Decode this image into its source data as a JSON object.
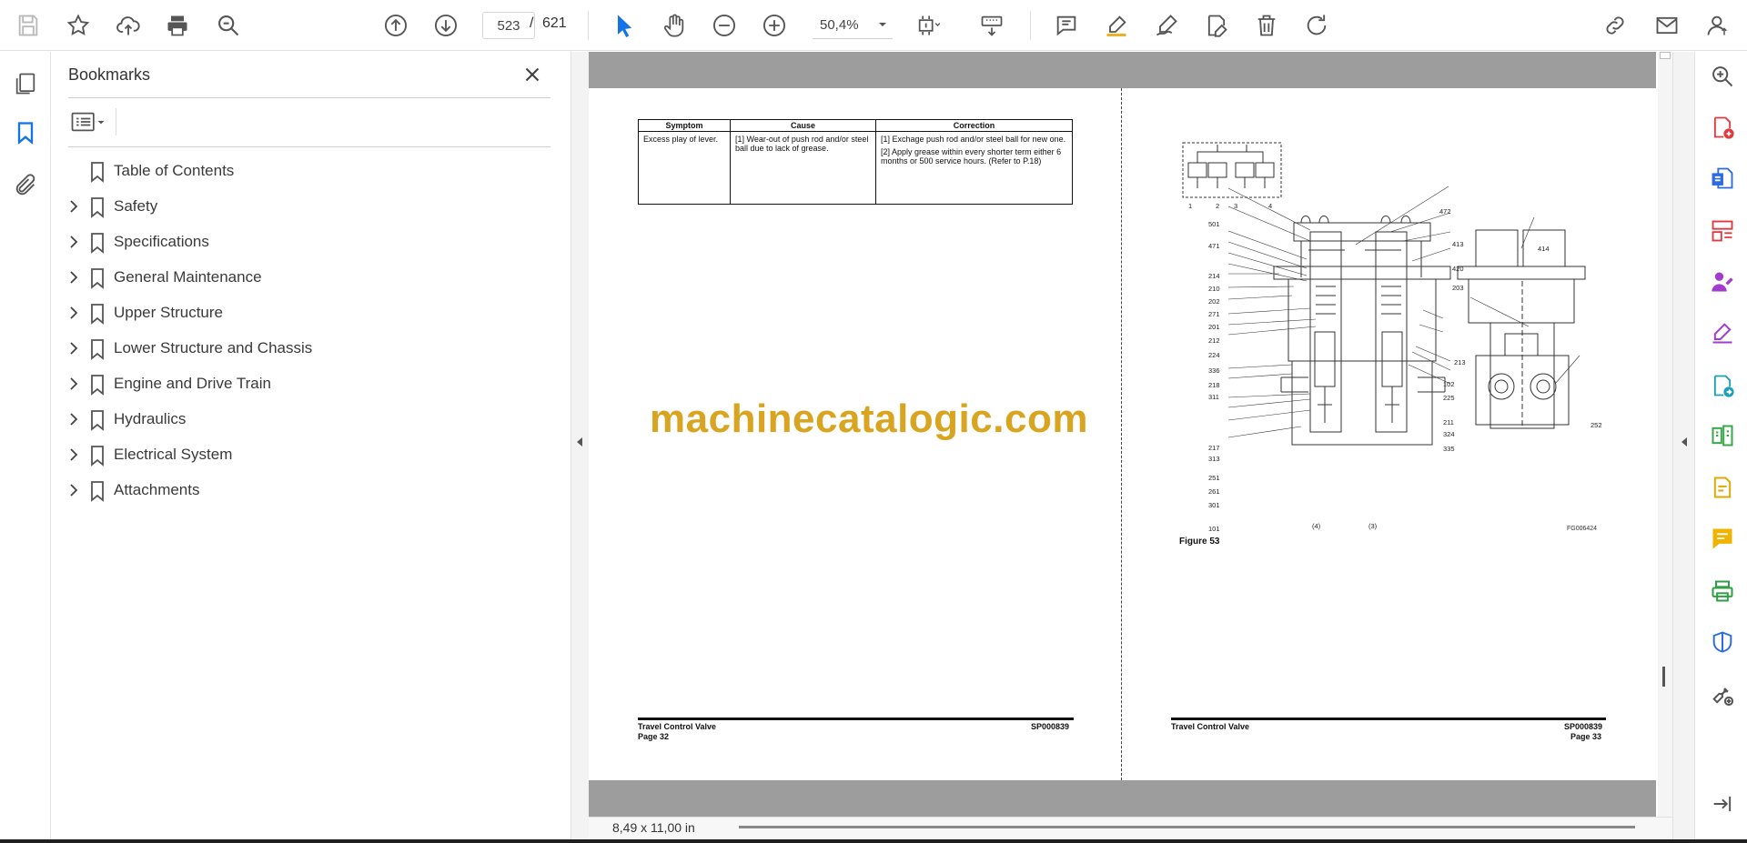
{
  "toolbar": {
    "page_current": "523",
    "page_separator": "/",
    "page_total": "621",
    "zoom": "50,4%"
  },
  "bookmarks": {
    "title": "Bookmarks",
    "items": [
      {
        "label": "Table of Contents",
        "expandable": false
      },
      {
        "label": "Safety",
        "expandable": true
      },
      {
        "label": "Specifications",
        "expandable": true
      },
      {
        "label": "General Maintenance",
        "expandable": true
      },
      {
        "label": "Upper Structure",
        "expandable": true
      },
      {
        "label": "Lower Structure and Chassis",
        "expandable": true
      },
      {
        "label": "Engine and Drive Train",
        "expandable": true
      },
      {
        "label": "Hydraulics",
        "expandable": true
      },
      {
        "label": "Electrical System",
        "expandable": true
      },
      {
        "label": "Attachments",
        "expandable": true
      }
    ]
  },
  "document": {
    "table": {
      "headers": [
        "Symptom",
        "Cause",
        "Correction"
      ],
      "symptom": "Excess play of lever.",
      "cause": "[1] Wear-out of push rod and/or steel ball due to lack of grease.",
      "correction_1": "[1] Exchage push rod and/or steel ball for new one.",
      "correction_2": "[2] Apply grease within every shorter term either 6 months or 500 service hours. (Refer to P.18)"
    },
    "watermark": "machinecatalogic.com",
    "left_footer": {
      "title": "Travel Control Valve",
      "page": "Page 32",
      "code": "SP000839"
    },
    "right_footer": {
      "title": "Travel Control Valve",
      "page": "Page 33",
      "code": "SP000839"
    },
    "figure_caption": "Figure 53",
    "figure_code": "FG006424",
    "figure_labels": {
      "top": [
        "1",
        "2",
        "3",
        "4"
      ],
      "left": [
        "501",
        "471",
        "214",
        "210",
        "202",
        "271",
        "201",
        "212",
        "224",
        "336",
        "218",
        "311",
        "217",
        "313",
        "251",
        "261",
        "301",
        "101"
      ],
      "right": [
        "472",
        "413",
        "420",
        "203",
        "102",
        "225",
        "211",
        "324",
        "335"
      ],
      "side": [
        "414",
        "213",
        "252"
      ],
      "bottom": [
        "(4)",
        "(3)"
      ]
    }
  },
  "status": {
    "page_size": "8,49 x 11,00 in"
  },
  "colors": {
    "accent_blue": "#1473e6",
    "watermark": "#d9a521",
    "doc_gray": "#9d9d9d"
  }
}
